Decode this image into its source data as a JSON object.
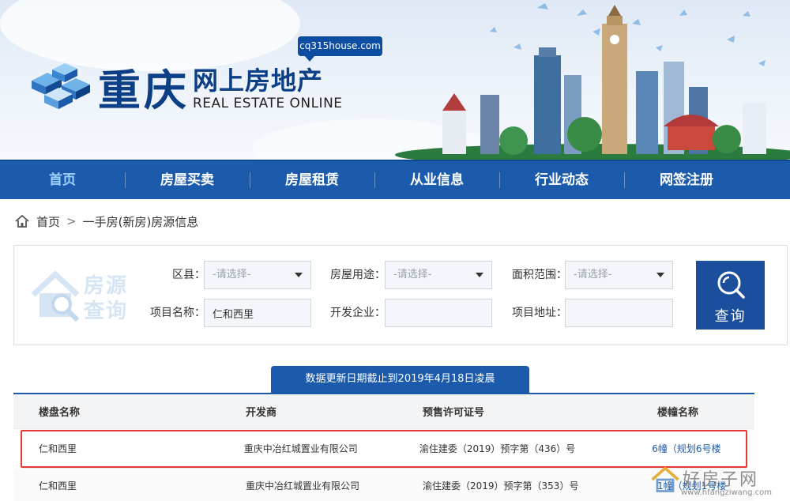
{
  "header": {
    "domain": "cq315house.com",
    "logo_city": "重庆",
    "logo_title": "网上房地产",
    "logo_en": "REAL ESTATE ONLINE"
  },
  "nav": {
    "items": [
      {
        "label": "首页",
        "active": true
      },
      {
        "label": "房屋买卖"
      },
      {
        "label": "房屋租赁"
      },
      {
        "label": "从业信息"
      },
      {
        "label": "行业动态"
      },
      {
        "label": "网签注册"
      }
    ]
  },
  "breadcrumb": {
    "home": "首页",
    "sep": ">",
    "current": "一手房(新房)房源信息"
  },
  "search": {
    "logo_line1": "房源",
    "logo_line2": "查询",
    "district_label": "区县：",
    "district_value": "-请选择-",
    "usage_label": "房屋用途：",
    "usage_value": "-请选择-",
    "area_label": "面积范围：",
    "area_value": "-请选择-",
    "project_label": "项目名称：",
    "project_value": "仁和西里",
    "developer_label": "开发企业：",
    "developer_value": "",
    "address_label": "项目地址：",
    "address_value": "",
    "query_label": "查询"
  },
  "update_notice": "数据更新日期截止到2019年4月18日凌晨",
  "table": {
    "headers": [
      "楼盘名称",
      "开发商",
      "预售许可证号",
      "楼幢名称"
    ],
    "rows": [
      [
        "仁和西里",
        "重庆中冶红城置业有限公司",
        "渝住建委（2019）预字第（436）号",
        "6幢（规划6号楼"
      ],
      [
        "仁和西里",
        "重庆中冶红城置业有限公司",
        "渝住建委（2019）预字第（353）号",
        "1幢（规划1号楼"
      ]
    ]
  },
  "watermark": {
    "text": "好房子网",
    "url": "www.hfangziwang.com"
  },
  "colors": {
    "nav_blue": "#1c5bac",
    "logo_blue": "#0d3f86",
    "highlight_red": "#e53935"
  }
}
